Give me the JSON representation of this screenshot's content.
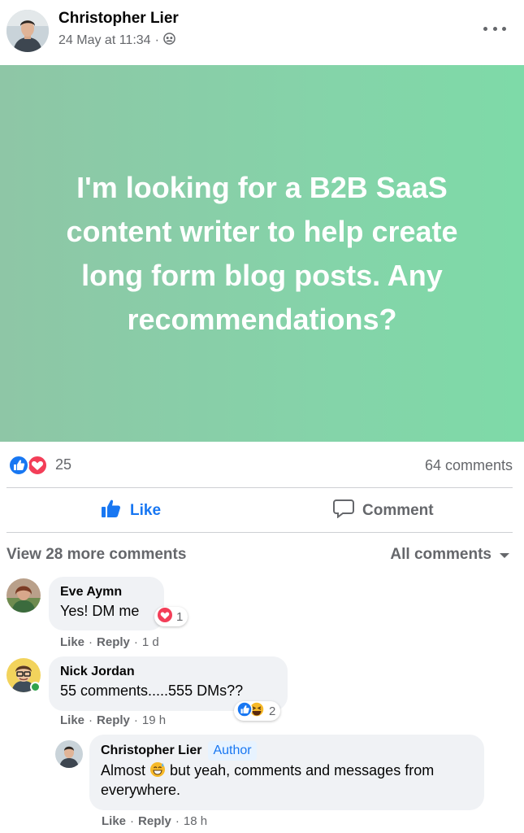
{
  "post": {
    "author": "Christopher Lier",
    "date": "24 May at 11:34",
    "separator": "·",
    "audience_icon": "group-audience-icon",
    "more_icon": "more-options-icon",
    "message": "I'm looking for a B2B SaaS content writer to help create long form blog posts. Any recommendations?",
    "banner_color": "#85d3a9"
  },
  "stats": {
    "reaction_count": "25",
    "comment_count": "64 comments",
    "reaction_icons": [
      "like-reaction-icon",
      "love-reaction-icon"
    ]
  },
  "actions": {
    "like_label": "Like",
    "comment_label": "Comment"
  },
  "comments_header": {
    "view_more": "View 28 more comments",
    "filter": "All comments"
  },
  "comments": [
    {
      "name": "Eve Aymn",
      "text": "Yes! DM me",
      "reaction_count": "1",
      "like": "Like",
      "reply": "Reply",
      "time": "1 d"
    },
    {
      "name": "Nick Jordan",
      "text": "55 comments.....555 DMs??",
      "reaction_count": "2",
      "like": "Like",
      "reply": "Reply",
      "time": "19 h"
    }
  ],
  "reply": {
    "name": "Christopher Lier",
    "badge": "Author",
    "text_before": "Almost",
    "text_after": "but yeah, comments and messages from everywhere.",
    "like": "Like",
    "reply": "Reply",
    "time": "18 h"
  },
  "colors": {
    "accent": "#1877f2",
    "love": "#f33e58",
    "muted": "#65676b",
    "online": "#31a24c"
  }
}
